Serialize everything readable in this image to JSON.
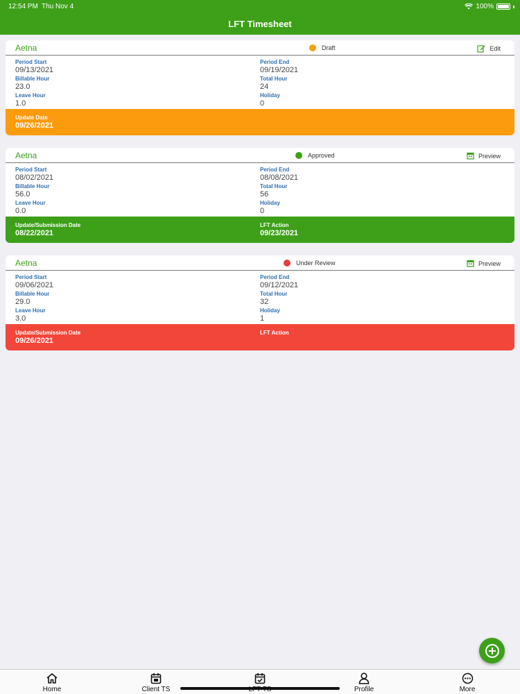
{
  "status_bar": {
    "time": "12:54 PM",
    "date": "Thu Nov 4",
    "battery": "100%"
  },
  "header": {
    "title": "LFT Timesheet"
  },
  "cards": [
    {
      "client": "Aetna",
      "status": "Draft",
      "status_color": "#f5a00f",
      "action": "Edit",
      "action_icon": "edit-icon",
      "period_start_label": "Period Start",
      "period_start": "09/13/2021",
      "period_end_label": "Period End",
      "period_end": "09/19/2021",
      "billable_label": "Billable Hour",
      "billable": "23.0",
      "total_label": "Total Hour",
      "total": "24",
      "leave_label": "Leave Hour",
      "leave": "1.0",
      "holiday_label": "Holiday",
      "holiday": "0",
      "footer_color": "#fb9b0d",
      "date_label": "Update Date",
      "date_value": "09/26/2021",
      "lft_label": "",
      "lft_value": ""
    },
    {
      "client": "Aetna",
      "status": "Approved",
      "status_color": "#3da018",
      "action": "Preview",
      "action_icon": "calendar-icon",
      "period_start_label": "Period Start",
      "period_start": "08/02/2021",
      "period_end_label": "Period End",
      "period_end": "08/08/2021",
      "billable_label": "Billable Hour",
      "billable": "56.0",
      "total_label": "Total Hour",
      "total": "56",
      "leave_label": "Leave Hour",
      "leave": "0.0",
      "holiday_label": "Holiday",
      "holiday": "0",
      "footer_color": "#3da018",
      "date_label": "Update/Submission Date",
      "date_value": "08/22/2021",
      "lft_label": "LFT Action",
      "lft_value": "09/23/2021"
    },
    {
      "client": "Aetna",
      "status": "Under Review",
      "status_color": "#e83c3c",
      "action": "Preview",
      "action_icon": "calendar-icon",
      "period_start_label": "Period Start",
      "period_start": "09/06/2021",
      "period_end_label": "Period End",
      "period_end": "09/12/2021",
      "billable_label": "Billable Hour",
      "billable": "29.0",
      "total_label": "Total Hour",
      "total": "32",
      "leave_label": "Leave Hour",
      "leave": "3.0",
      "holiday_label": "Holiday",
      "holiday": "1",
      "footer_color": "#f2463b",
      "date_label": "Update/Submission Date",
      "date_value": "09/26/2021",
      "lft_label": "LFT Action",
      "lft_value": ""
    }
  ],
  "fab": {
    "icon": "add-circle-icon"
  },
  "tabs": [
    {
      "label": "Home",
      "icon": "home-icon"
    },
    {
      "label": "Client TS",
      "icon": "calendar-icon"
    },
    {
      "label": "LFT TS",
      "icon": "calendar-check-icon"
    },
    {
      "label": "Profile",
      "icon": "person-icon"
    },
    {
      "label": "More",
      "icon": "more-icon"
    }
  ]
}
